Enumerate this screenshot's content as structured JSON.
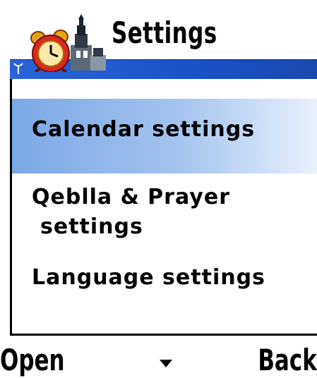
{
  "header": {
    "title": "Settings"
  },
  "menu": {
    "items": [
      {
        "label": "Calendar settings",
        "selected": true
      },
      {
        "label_line1": "Qeblla & Prayer",
        "label_line2": "settings",
        "selected": false
      },
      {
        "label": "Language settings",
        "selected": false
      }
    ]
  },
  "softkeys": {
    "left": "Open",
    "right": "Back"
  },
  "colors": {
    "header_bar": "#1a52c8",
    "selection_start": "#7aa8e6",
    "selection_end": "#e9f1fb",
    "text": "#000000",
    "background": "#ffffff"
  }
}
